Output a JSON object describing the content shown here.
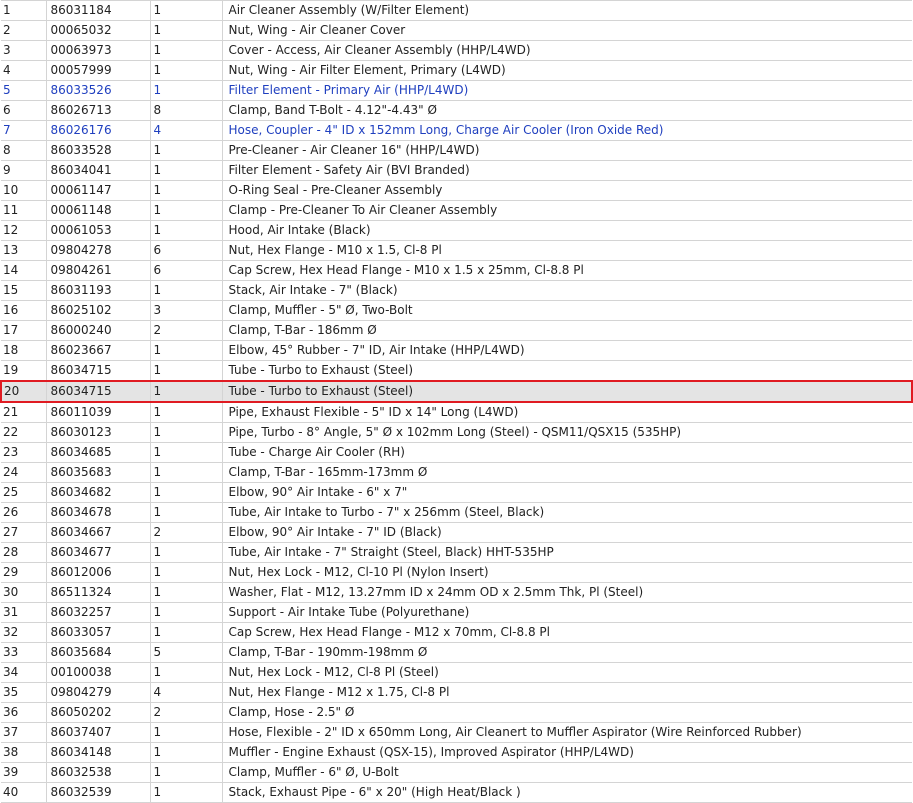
{
  "table": {
    "selected_row": 19,
    "rows": [
      {
        "num": "1",
        "part": "86031184",
        "qty": "1",
        "desc": "Air Cleaner Assembly (W/Filter Element)",
        "link": false
      },
      {
        "num": "2",
        "part": "00065032",
        "qty": "1",
        "desc": "Nut, Wing - Air Cleaner Cover",
        "link": false
      },
      {
        "num": "3",
        "part": "00063973",
        "qty": "1",
        "desc": "Cover - Access, Air Cleaner Assembly (HHP/L4WD)",
        "link": false
      },
      {
        "num": "4",
        "part": "00057999",
        "qty": "1",
        "desc": "Nut, Wing - Air Filter Element, Primary (L4WD)",
        "link": false
      },
      {
        "num": "5",
        "part": "86033526",
        "qty": "1",
        "desc": "Filter Element - Primary Air (HHP/L4WD)",
        "link": true
      },
      {
        "num": "6",
        "part": "86026713",
        "qty": "8",
        "desc": "Clamp, Band T-Bolt - 4.12\"-4.43\" Ø",
        "link": false
      },
      {
        "num": "7",
        "part": "86026176",
        "qty": "4",
        "desc": "Hose, Coupler - 4\" ID x 152mm Long, Charge Air Cooler (Iron Oxide Red)",
        "link": true
      },
      {
        "num": "8",
        "part": "86033528",
        "qty": "1",
        "desc": "Pre-Cleaner - Air Cleaner 16\" (HHP/L4WD)",
        "link": false
      },
      {
        "num": "9",
        "part": "86034041",
        "qty": "1",
        "desc": "Filter Element - Safety Air (BVI Branded)",
        "link": false
      },
      {
        "num": "10",
        "part": "00061147",
        "qty": "1",
        "desc": "O-Ring Seal - Pre-Cleaner Assembly",
        "link": false
      },
      {
        "num": "11",
        "part": "00061148",
        "qty": "1",
        "desc": "Clamp - Pre-Cleaner To Air Cleaner Assembly",
        "link": false
      },
      {
        "num": "12",
        "part": "00061053",
        "qty": "1",
        "desc": "Hood, Air Intake (Black)",
        "link": false
      },
      {
        "num": "13",
        "part": "09804278",
        "qty": "6",
        "desc": "Nut, Hex Flange - M10 x 1.5, Cl-8 Pl",
        "link": false
      },
      {
        "num": "14",
        "part": "09804261",
        "qty": "6",
        "desc": "Cap Screw, Hex Head Flange - M10 x 1.5 x 25mm, Cl-8.8 Pl",
        "link": false
      },
      {
        "num": "15",
        "part": "86031193",
        "qty": "1",
        "desc": "Stack, Air Intake - 7\" (Black)",
        "link": false
      },
      {
        "num": "16",
        "part": "86025102",
        "qty": "3",
        "desc": "Clamp, Muffler - 5\" Ø, Two-Bolt",
        "link": false
      },
      {
        "num": "17",
        "part": "86000240",
        "qty": "2",
        "desc": "Clamp, T-Bar - 186mm Ø",
        "link": false
      },
      {
        "num": "18",
        "part": "86023667",
        "qty": "1",
        "desc": "Elbow, 45° Rubber - 7\" ID, Air Intake (HHP/L4WD)",
        "link": false
      },
      {
        "num": "19",
        "part": "86034715",
        "qty": "1",
        "desc": "Tube - Turbo to Exhaust (Steel)",
        "link": false
      },
      {
        "num": "20",
        "part": "86034715",
        "qty": "1",
        "desc": "Tube - Turbo to Exhaust (Steel)",
        "link": false
      },
      {
        "num": "21",
        "part": "86011039",
        "qty": "1",
        "desc": "Pipe, Exhaust Flexible - 5\" ID x 14\" Long (L4WD)",
        "link": false
      },
      {
        "num": "22",
        "part": "86030123",
        "qty": "1",
        "desc": "Pipe, Turbo - 8° Angle, 5\" Ø x 102mm Long (Steel) - QSM11/QSX15 (535HP)",
        "link": false
      },
      {
        "num": "23",
        "part": "86034685",
        "qty": "1",
        "desc": "Tube - Charge Air Cooler (RH)",
        "link": false
      },
      {
        "num": "24",
        "part": "86035683",
        "qty": "1",
        "desc": "Clamp, T-Bar - 165mm-173mm Ø",
        "link": false
      },
      {
        "num": "25",
        "part": "86034682",
        "qty": "1",
        "desc": "Elbow, 90° Air Intake - 6\" x 7\"",
        "link": false
      },
      {
        "num": "26",
        "part": "86034678",
        "qty": "1",
        "desc": "Tube, Air Intake to Turbo - 7\" x 256mm (Steel, Black)",
        "link": false
      },
      {
        "num": "27",
        "part": "86034667",
        "qty": "2",
        "desc": "Elbow, 90° Air Intake - 7\" ID (Black)",
        "link": false
      },
      {
        "num": "28",
        "part": "86034677",
        "qty": "1",
        "desc": "Tube, Air Intake - 7\" Straight (Steel, Black) HHT-535HP",
        "link": false
      },
      {
        "num": "29",
        "part": "86012006",
        "qty": "1",
        "desc": "Nut, Hex Lock - M12, Cl-10 Pl (Nylon Insert)",
        "link": false
      },
      {
        "num": "30",
        "part": "86511324",
        "qty": "1",
        "desc": "Washer, Flat - M12, 13.27mm ID x 24mm OD x 2.5mm Thk, Pl (Steel)",
        "link": false
      },
      {
        "num": "31",
        "part": "86032257",
        "qty": "1",
        "desc": "Support - Air Intake Tube (Polyurethane)",
        "link": false
      },
      {
        "num": "32",
        "part": "86033057",
        "qty": "1",
        "desc": "Cap Screw, Hex Head Flange - M12 x 70mm, Cl-8.8 Pl",
        "link": false
      },
      {
        "num": "33",
        "part": "86035684",
        "qty": "5",
        "desc": "Clamp, T-Bar - 190mm-198mm Ø",
        "link": false
      },
      {
        "num": "34",
        "part": "00100038",
        "qty": "1",
        "desc": "Nut, Hex Lock - M12, Cl-8 Pl (Steel)",
        "link": false
      },
      {
        "num": "35",
        "part": "09804279",
        "qty": "4",
        "desc": "Nut, Hex Flange - M12 x 1.75, Cl-8 Pl",
        "link": false
      },
      {
        "num": "36",
        "part": "86050202",
        "qty": "2",
        "desc": "Clamp, Hose - 2.5\" Ø",
        "link": false
      },
      {
        "num": "37",
        "part": "86037407",
        "qty": "1",
        "desc": "Hose, Flexible - 2\" ID x 650mm Long, Air Cleanert to Muffler Aspirator (Wire Reinforced Rubber)",
        "link": false
      },
      {
        "num": "38",
        "part": "86034148",
        "qty": "1",
        "desc": "Muffler - Engine Exhaust (QSX-15), Improved Aspirator (HHP/L4WD)",
        "link": false
      },
      {
        "num": "39",
        "part": "86032538",
        "qty": "1",
        "desc": "Clamp, Muffler - 6\" Ø, U-Bolt",
        "link": false
      },
      {
        "num": "40",
        "part": "86032539",
        "qty": "1",
        "desc": "Stack, Exhaust Pipe - 6\" x 20\" (High Heat/Black )",
        "link": false
      }
    ]
  }
}
